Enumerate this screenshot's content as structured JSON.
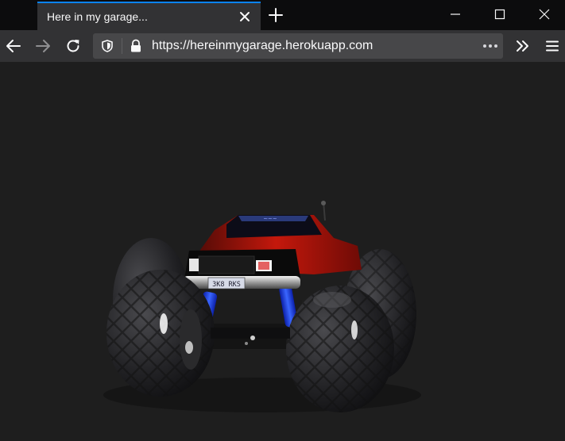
{
  "browser": {
    "tab": {
      "title": "Here in my garage..."
    },
    "address_bar": {
      "url": "https://hereinmygarage.herokuapp.com"
    },
    "toolbar": {
      "back_icon": "arrow-left-icon",
      "forward_icon": "arrow-right-icon",
      "reload_icon": "reload-icon",
      "overflow_icon": "chevrons-right-icon",
      "menu_icon": "hamburger-menu-icon"
    },
    "colors": {
      "accent": "#0a84ff",
      "tabstrip": "#0c0c0d",
      "toolbar": "#323234",
      "urlbar": "#474749",
      "content_bg": "#1e1e1e"
    }
  },
  "page": {
    "scene": "3d-monster-truck-render",
    "license_plate": "3K8 RKS"
  }
}
